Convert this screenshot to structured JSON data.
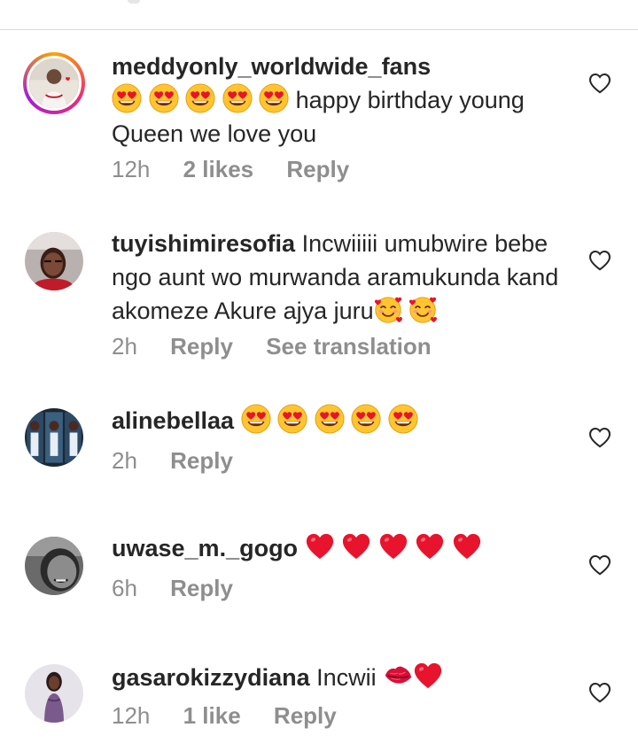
{
  "comments": [
    {
      "username": "meddyonly_worldwide_fans",
      "text_after_emoji": "happy birthday young Queen we love you",
      "time": "12h",
      "likes": "2 likes",
      "reply": "Reply",
      "emojis": [
        "heart-eyes",
        "heart-eyes",
        "heart-eyes",
        "heart-eyes",
        "heart-eyes"
      ]
    },
    {
      "username": "tuyishimiresofia",
      "text": "Incwiiiii umubwire bebe ngo aunt wo murwanda aramukunda kand akomeze Akure ajya juru",
      "time": "2h",
      "reply": "Reply",
      "see_translation": "See translation",
      "emojis": [
        "smiling-face-with-hearts",
        "smiling-face-with-hearts"
      ]
    },
    {
      "username": "alinebellaa",
      "time": "2h",
      "reply": "Reply",
      "emojis": [
        "heart-eyes",
        "heart-eyes",
        "heart-eyes",
        "heart-eyes",
        "heart-eyes"
      ]
    },
    {
      "username": "uwase_m._gogo",
      "time": "6h",
      "reply": "Reply",
      "emojis": [
        "red-heart",
        "red-heart",
        "red-heart",
        "red-heart",
        "red-heart"
      ]
    },
    {
      "username": "gasarokizzydiana",
      "text": "Incwii",
      "time": "12h",
      "likes": "1 like",
      "reply": "Reply",
      "emojis": [
        "kiss-mark",
        "red-heart"
      ]
    }
  ],
  "icons": {
    "like": "heart-outline-icon"
  },
  "colors": {
    "meta": "#8e8e8e",
    "text": "#262626",
    "emoji_heart": "#e8132c",
    "emoji_face": "#ffc52e"
  }
}
